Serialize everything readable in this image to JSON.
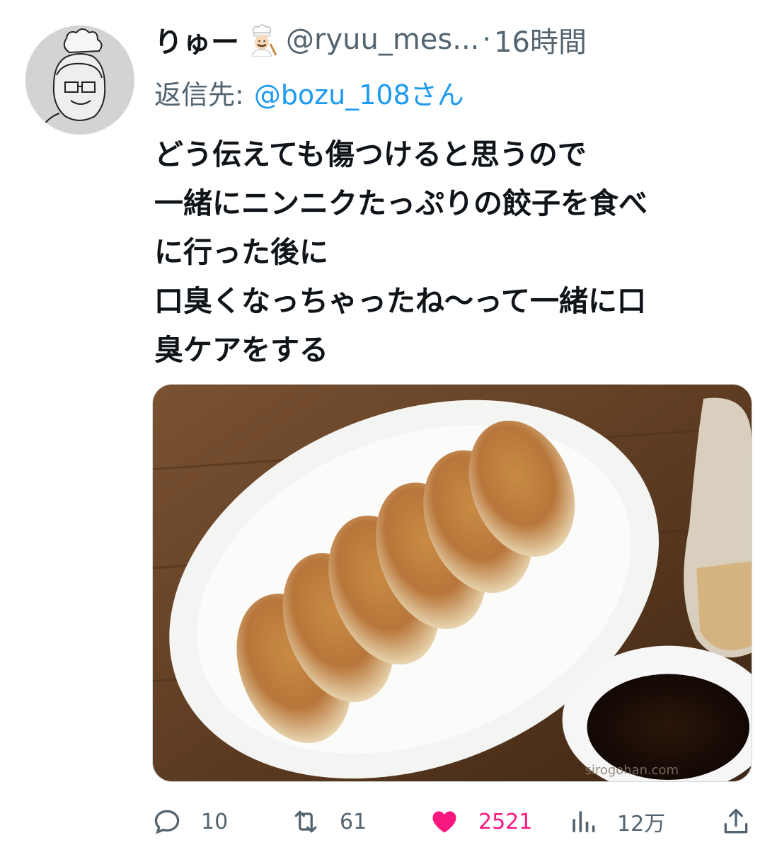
{
  "tweet": {
    "display_name": "りゅー",
    "handle": "@ryuu_mes...",
    "separator": "·",
    "time": "16時間",
    "reply_label": "返信先:",
    "reply_to": "@bozu_108さん",
    "text_lines": [
      "どう伝えても傷つけると思うので",
      "一緒にニンニクたっぷりの餃子を食べ",
      "に行った後に",
      "口臭くなっちゃったね〜って一緒に口",
      "臭ケアをする"
    ],
    "media": {
      "watermark": "sirogohan.com"
    },
    "actions": {
      "reply": {
        "icon": "reply-icon",
        "count": "10"
      },
      "retweet": {
        "icon": "retweet-icon",
        "count": "61"
      },
      "like": {
        "icon": "heart-icon",
        "count": "2521",
        "color": "#f91880"
      },
      "views": {
        "icon": "views-icon",
        "count": "12万"
      },
      "share": {
        "icon": "share-icon"
      }
    }
  },
  "colors": {
    "text": "#0f1419",
    "secondary": "#536471",
    "link": "#1d9bf0",
    "like": "#f91880"
  }
}
